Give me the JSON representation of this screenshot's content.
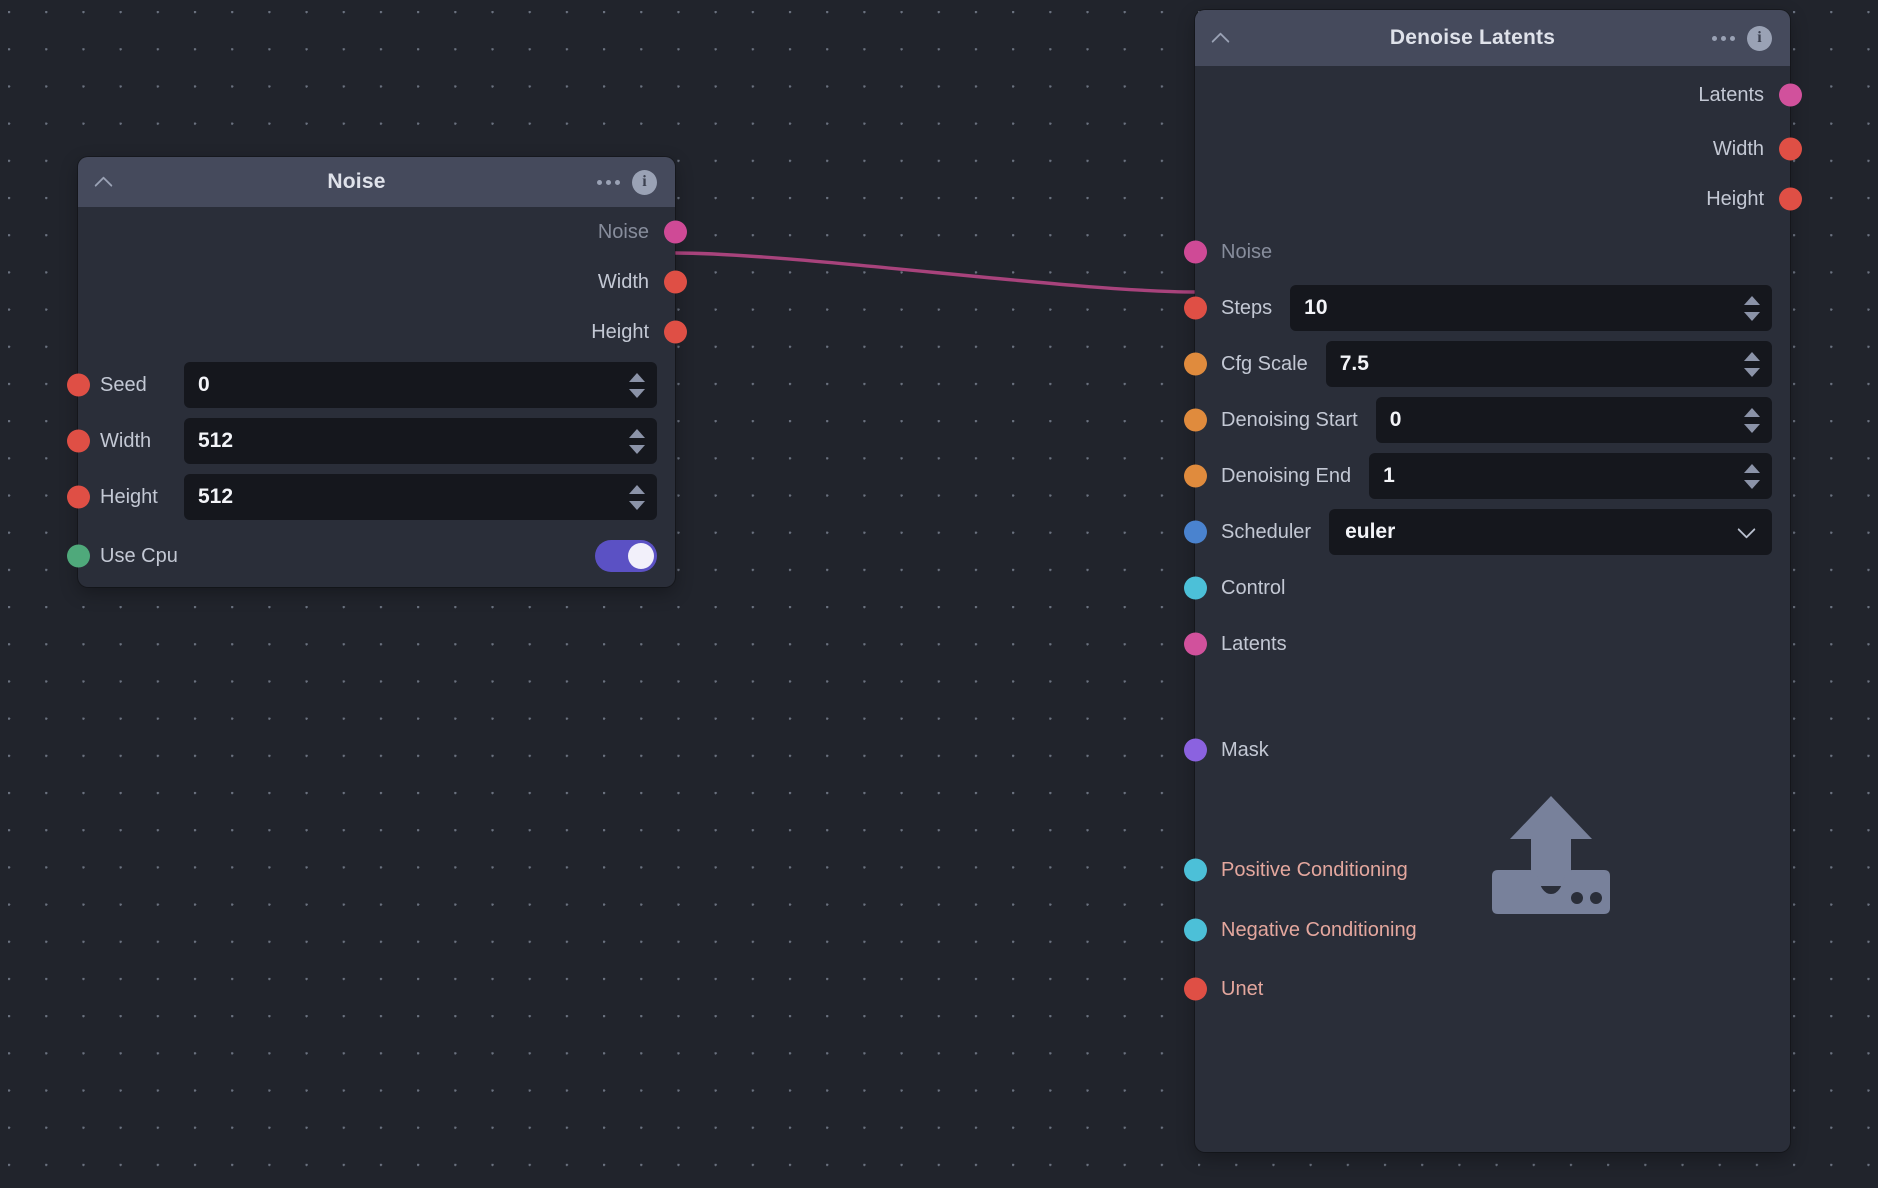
{
  "canvas": {
    "background_color": "#21242c",
    "grid_dot_color": "#6b7280",
    "edge_color": "#a8437c"
  },
  "socket_colors": {
    "latents_pink": "#d1519c",
    "noise_pink": "#cf4a96",
    "int_red": "#df4f45",
    "float_orange": "#e08b3d",
    "scheduler_blue": "#4a83cf",
    "control_cyan": "#4cc0d8",
    "conditioning_cyan": "#4cc0d8",
    "mask_purple": "#8b62e0",
    "bool_green": "#4fa97b",
    "unet_red": "#df4f45"
  },
  "nodes": [
    {
      "id": "noise",
      "header": {
        "title": "Noise",
        "collapse_icon": "chevron-up-icon",
        "menu_icon": "more-options-icon",
        "info_icon": "info-icon"
      },
      "outputs": [
        {
          "label": "Noise",
          "color": "#cf4a96",
          "dimmed": true
        },
        {
          "label": "Width",
          "color": "#df4f45",
          "dimmed": false
        },
        {
          "label": "Height",
          "color": "#df4f45",
          "dimmed": false
        }
      ],
      "fields": [
        {
          "label": "Seed",
          "type": "number",
          "value": "0",
          "color": "#df4f45"
        },
        {
          "label": "Width",
          "type": "number",
          "value": "512",
          "color": "#df4f45"
        },
        {
          "label": "Height",
          "type": "number",
          "value": "512",
          "color": "#df4f45"
        },
        {
          "label": "Use Cpu",
          "type": "toggle",
          "value": "on",
          "color": "#4fa97b"
        }
      ]
    },
    {
      "id": "denoise_latents",
      "header": {
        "title": "Denoise Latents",
        "collapse_icon": "chevron-up-icon",
        "menu_icon": "more-options-icon",
        "info_icon": "info-icon"
      },
      "outputs": [
        {
          "label": "Latents",
          "color": "#d1519c"
        },
        {
          "label": "Width",
          "color": "#df4f45"
        },
        {
          "label": "Height",
          "color": "#df4f45"
        }
      ],
      "inputs": [
        {
          "label": "Noise",
          "type": "socket",
          "color": "#cf4a96",
          "dimmed": true
        },
        {
          "label": "Steps",
          "type": "number",
          "value": "10",
          "color": "#df4f45"
        },
        {
          "label": "Cfg Scale",
          "type": "number",
          "value": "7.5",
          "color": "#e08b3d"
        },
        {
          "label": "Denoising Start",
          "type": "number",
          "value": "0",
          "color": "#e08b3d"
        },
        {
          "label": "Denoising End",
          "type": "number",
          "value": "1",
          "color": "#e08b3d"
        },
        {
          "label": "Scheduler",
          "type": "select",
          "value": "euler",
          "color": "#4a83cf"
        },
        {
          "label": "Control",
          "type": "socket",
          "color": "#4cc0d8"
        },
        {
          "label": "Latents",
          "type": "socket",
          "color": "#d1519c"
        },
        {
          "label": "Mask",
          "type": "socket",
          "color": "#8b62e0"
        },
        {
          "label": "Positive Conditioning",
          "type": "socket",
          "color": "#4cc0d8",
          "required": true
        },
        {
          "label": "Negative Conditioning",
          "type": "socket",
          "color": "#4cc0d8",
          "required": true
        },
        {
          "label": "Unet",
          "type": "socket",
          "color": "#df4f45",
          "required": true
        }
      ],
      "drop_hint_icon": "upload-icon"
    }
  ],
  "connections": [
    {
      "from_node": "noise",
      "from_socket": "Noise",
      "to_node": "denoise_latents",
      "to_socket": "Noise",
      "color": "#a8437c"
    }
  ]
}
